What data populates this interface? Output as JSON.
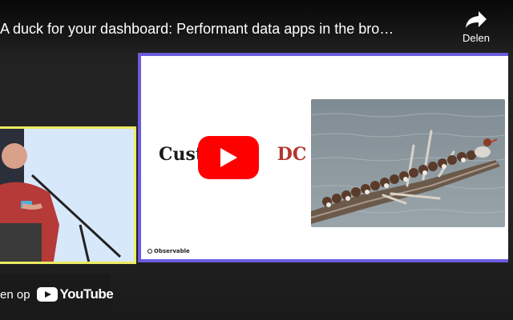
{
  "video": {
    "title": "A duck for your dashboard: Performant data apps in the bro…"
  },
  "share": {
    "label": "Delen",
    "icon": "share-arrow-icon"
  },
  "slide": {
    "title_visible_start": "Custo",
    "title_visible_end": "DC",
    "brand": "Observable"
  },
  "play_button": {
    "icon": "play-icon",
    "color": "#ff0000"
  },
  "watch_on": {
    "label": "en op",
    "logo_text": "YouTube"
  },
  "colors": {
    "slide_border": "#6b5ce0",
    "camera_border": "#ecec62",
    "slide_title_accent": "#b2362c"
  }
}
